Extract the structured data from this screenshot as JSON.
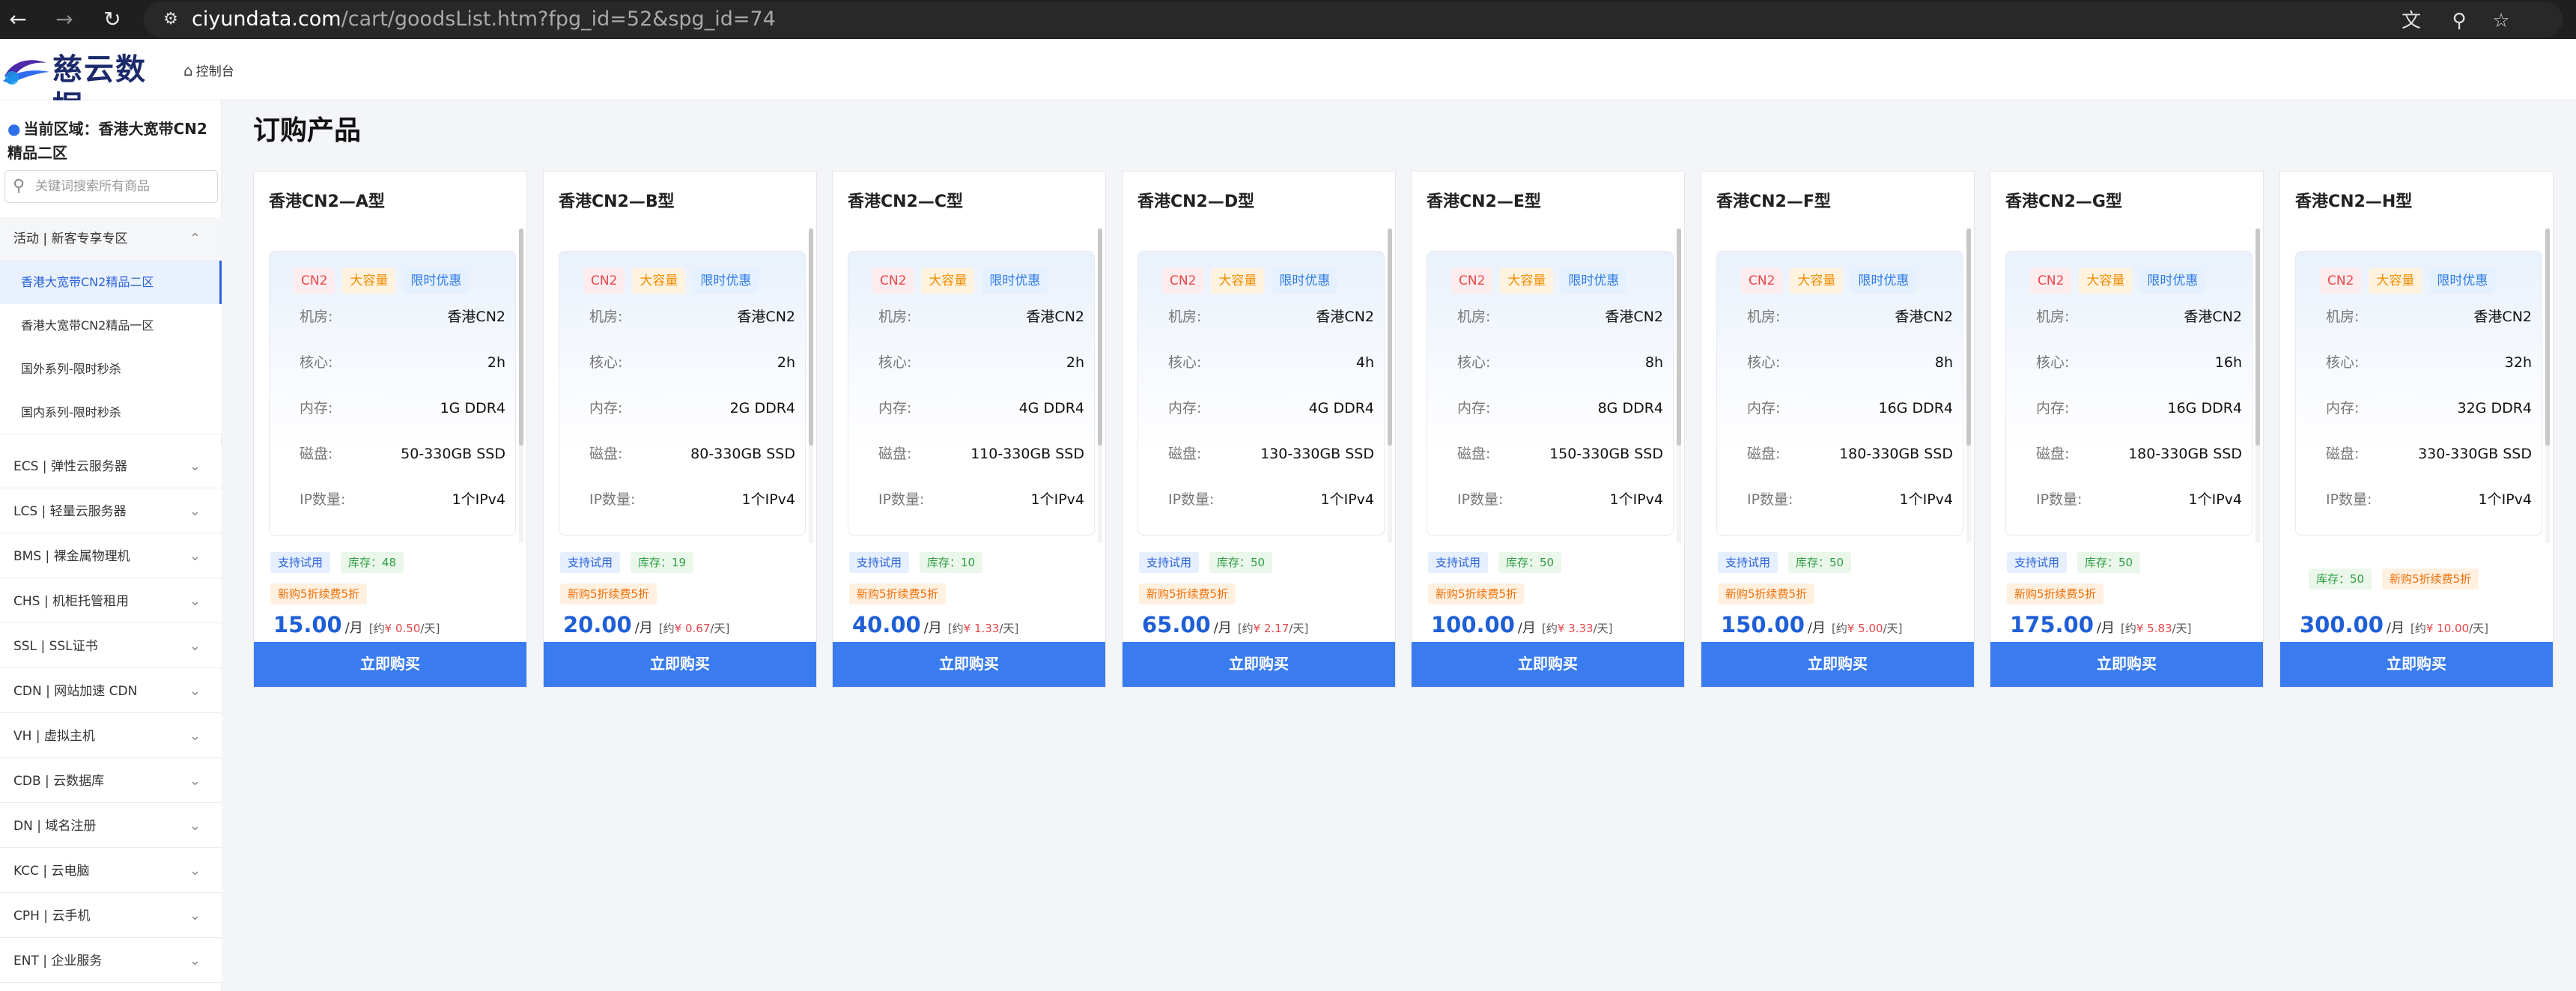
{
  "browser": {
    "url_host": "ciyundata.com",
    "url_rest": "/cart/goodsList.htm?fpg_id=52&spg_id=74"
  },
  "header": {
    "logo_text": "慈云数据",
    "console_label": "控制台"
  },
  "sidebar": {
    "region_label": "当前区域：香港大宽带CN2精品二区",
    "search_placeholder": "关键词搜索所有商品",
    "expanded_category": "活动 | 新客专享专区",
    "sub_items": [
      {
        "label": "香港大宽带CN2精品二区",
        "active": true
      },
      {
        "label": "香港大宽带CN2精品一区",
        "active": false
      },
      {
        "label": "国外系列-限时秒杀",
        "active": false
      },
      {
        "label": "国内系列-限时秒杀",
        "active": false
      }
    ],
    "categories": [
      "ECS | 弹性云服务器",
      "LCS | 轻量云服务器",
      "BMS | 裸金属物理机",
      "CHS | 机柜托管租用",
      "SSL | SSL证书",
      "CDN | 网站加速 CDN",
      "VH | 虚拟主机",
      "CDB | 云数据库",
      "DN | 域名注册",
      "KCC | 云电脑",
      "CPH | 云手机",
      "ENT | 企业服务"
    ]
  },
  "main": {
    "title": "订购产品",
    "buy_label": "立即购买",
    "tags": [
      "CN2",
      "大容量",
      "限时优惠"
    ],
    "spec_labels": {
      "room": "机房:",
      "core": "核心:",
      "mem": "内存:",
      "disk": "磁盘:",
      "ip": "IP数量:"
    },
    "try_label": "支持试用",
    "promo_label": "新购5折续费5折",
    "per_month": "/月",
    "products": [
      {
        "name": "香港CN2—A型",
        "room": "香港CN2",
        "core": "2h",
        "mem": "1G DDR4",
        "disk": "50-330GB SSD",
        "ip": "1个IPv4",
        "try": true,
        "stock": "库存：48",
        "price": "15.00",
        "daily_prefix": "[约",
        "daily_money": "¥ 0.50",
        "daily_suffix": "/天]"
      },
      {
        "name": "香港CN2—B型",
        "room": "香港CN2",
        "core": "2h",
        "mem": "2G DDR4",
        "disk": "80-330GB SSD",
        "ip": "1个IPv4",
        "try": true,
        "stock": "库存：19",
        "price": "20.00",
        "daily_prefix": "[约",
        "daily_money": "¥ 0.67",
        "daily_suffix": "/天]"
      },
      {
        "name": "香港CN2—C型",
        "room": "香港CN2",
        "core": "2h",
        "mem": "4G DDR4",
        "disk": "110-330GB SSD",
        "ip": "1个IPv4",
        "try": true,
        "stock": "库存：10",
        "price": "40.00",
        "daily_prefix": "[约",
        "daily_money": "¥ 1.33",
        "daily_suffix": "/天]"
      },
      {
        "name": "香港CN2—D型",
        "room": "香港CN2",
        "core": "4h",
        "mem": "4G DDR4",
        "disk": "130-330GB SSD",
        "ip": "1个IPv4",
        "try": true,
        "stock": "库存：50",
        "price": "65.00",
        "daily_prefix": "[约",
        "daily_money": "¥ 2.17",
        "daily_suffix": "/天]"
      },
      {
        "name": "香港CN2—E型",
        "room": "香港CN2",
        "core": "8h",
        "mem": "8G DDR4",
        "disk": "150-330GB SSD",
        "ip": "1个IPv4",
        "try": true,
        "stock": "库存：50",
        "price": "100.00",
        "daily_prefix": "[约",
        "daily_money": "¥ 3.33",
        "daily_suffix": "/天]"
      },
      {
        "name": "香港CN2—F型",
        "room": "香港CN2",
        "core": "8h",
        "mem": "16G DDR4",
        "disk": "180-330GB SSD",
        "ip": "1个IPv4",
        "try": true,
        "stock": "库存：50",
        "price": "150.00",
        "daily_prefix": "[约",
        "daily_money": "¥ 5.00",
        "daily_suffix": "/天]"
      },
      {
        "name": "香港CN2—G型",
        "room": "香港CN2",
        "core": "16h",
        "mem": "16G DDR4",
        "disk": "180-330GB SSD",
        "ip": "1个IPv4",
        "try": true,
        "stock": "库存：50",
        "price": "175.00",
        "daily_prefix": "[约",
        "daily_money": "¥ 5.83",
        "daily_suffix": "/天]"
      },
      {
        "name": "香港CN2—H型",
        "room": "香港CN2",
        "core": "32h",
        "mem": "32G DDR4",
        "disk": "330-330GB SSD",
        "ip": "1个IPv4",
        "try": false,
        "stock": "库存：50",
        "price": "300.00",
        "daily_prefix": "[约",
        "daily_money": "¥ 10.00",
        "daily_suffix": "/天]"
      }
    ]
  },
  "colors": {
    "accent": "#3a7cf0",
    "price": "#1f5fd6",
    "stock_green": "#2f9e44",
    "promo_orange": "#f0700a"
  }
}
